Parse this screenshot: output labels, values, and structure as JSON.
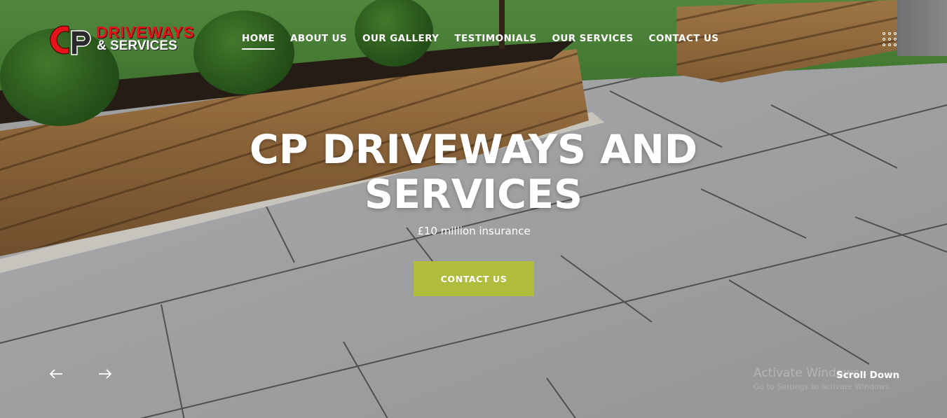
{
  "brand": {
    "logo_line1": "DRIVEWAYS",
    "logo_line2": "& SERVICES",
    "red": "#e4141a"
  },
  "nav": {
    "items": [
      {
        "label": "HOME",
        "active": true
      },
      {
        "label": "ABOUT US"
      },
      {
        "label": "OUR GALLERY"
      },
      {
        "label": "TESTIMONIALS"
      },
      {
        "label": "OUR SERVICES"
      },
      {
        "label": "CONTACT US"
      }
    ],
    "menu_icon": "grid-dots-icon"
  },
  "hero": {
    "title_line1": "CP DRIVEWAYS AND",
    "title_line2": "SERVICES",
    "subtitle": "£10 million insurance",
    "cta_label": "CONTACT US",
    "cta_color": "#b0bc3c",
    "prev_icon": "arrow-left-icon",
    "next_icon": "arrow-right-icon",
    "scroll_label": "Scroll Down"
  },
  "watermark": {
    "line1": "Activate Windows",
    "line2": "Go to Settings to activate Windows."
  }
}
